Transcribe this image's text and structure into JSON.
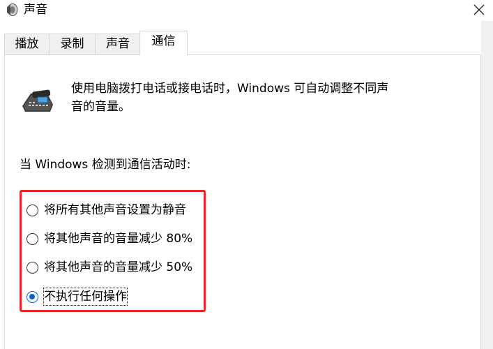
{
  "window": {
    "title": "声音"
  },
  "tabs": [
    {
      "label": "播放",
      "active": false
    },
    {
      "label": "录制",
      "active": false
    },
    {
      "label": "声音",
      "active": false
    },
    {
      "label": "通信",
      "active": true
    }
  ],
  "communications": {
    "description": "使用电脑拨打电话或接电话时，Windows 可自动调整不同声音的音量。",
    "prompt": "当 Windows 检测到通信活动时:",
    "options": [
      {
        "label": "将所有其他声音设置为静音",
        "checked": false
      },
      {
        "label": "将其他声音的音量减少 80%",
        "checked": false
      },
      {
        "label": "将其他声音的音量减少 50%",
        "checked": false
      },
      {
        "label": "不执行任何操作",
        "checked": true
      }
    ]
  },
  "colors": {
    "highlight_border": "#e8262b",
    "radio_checked": "#0a62d0"
  },
  "icons": {
    "title": "speaker-icon",
    "close": "close-icon",
    "communications": "telephone-icon"
  }
}
